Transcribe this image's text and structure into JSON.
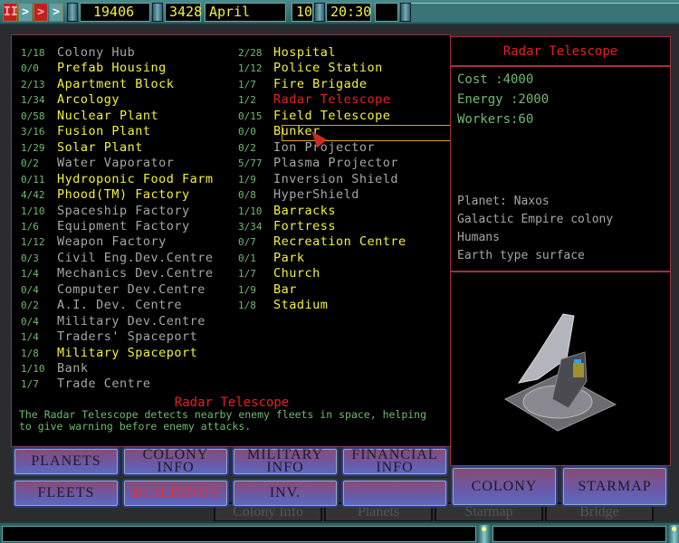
{
  "topbar": {
    "pause": "II",
    "play": ">",
    "fast": ">",
    "faster": ">",
    "credits": "19406",
    "year": "3428",
    "month": "April",
    "day": "10",
    "time": "20:30"
  },
  "background_tabs": [
    "Colony Info",
    "Planets",
    "Starmap",
    "Bridge"
  ],
  "buildings_left": [
    {
      "count": "1/18",
      "name": "Colony Hub",
      "available": false
    },
    {
      "count": "0/0",
      "name": "Prefab Housing",
      "available": true
    },
    {
      "count": "2/13",
      "name": "Apartment Block",
      "available": true
    },
    {
      "count": "1/34",
      "name": "Arcology",
      "available": true
    },
    {
      "count": "0/58",
      "name": "Nuclear Plant",
      "available": true
    },
    {
      "count": "3/16",
      "name": "Fusion Plant",
      "available": true
    },
    {
      "count": "1/29",
      "name": "Solar Plant",
      "available": true
    },
    {
      "count": "0/2",
      "name": "Water Vaporator",
      "available": false
    },
    {
      "count": "0/11",
      "name": "Hydroponic Food Farm",
      "available": true
    },
    {
      "count": "4/42",
      "name": "Phood(TM) Factory",
      "available": true
    },
    {
      "count": "1/10",
      "name": "Spaceship Factory",
      "available": false
    },
    {
      "count": "1/6",
      "name": "Equipment Factory",
      "available": false
    },
    {
      "count": "1/12",
      "name": "Weapon Factory",
      "available": false
    },
    {
      "count": "0/3",
      "name": "Civil Eng.Dev.Centre",
      "available": false
    },
    {
      "count": "1/4",
      "name": "Mechanics Dev.Centre",
      "available": false
    },
    {
      "count": "0/4",
      "name": "Computer Dev.Centre",
      "available": false
    },
    {
      "count": "0/2",
      "name": "A.I. Dev. Centre",
      "available": false
    },
    {
      "count": "0/4",
      "name": "Military Dev.Centre",
      "available": false
    },
    {
      "count": "1/4",
      "name": "Traders' Spaceport",
      "available": false
    },
    {
      "count": "1/8",
      "name": "Military Spaceport",
      "available": true
    },
    {
      "count": "1/10",
      "name": "Bank",
      "available": false
    },
    {
      "count": "1/7",
      "name": "Trade Centre",
      "available": false
    }
  ],
  "buildings_right": [
    {
      "count": "2/28",
      "name": "Hospital",
      "available": true
    },
    {
      "count": "1/12",
      "name": "Police Station",
      "available": true
    },
    {
      "count": "1/7",
      "name": "Fire Brigade",
      "available": true
    },
    {
      "count": "1/2",
      "name": "Radar Telescope",
      "available": true,
      "selected": true
    },
    {
      "count": "0/15",
      "name": "Field Telescope",
      "available": true
    },
    {
      "count": "0/0",
      "name": "Bunker",
      "available": true
    },
    {
      "count": "0/2",
      "name": "Ion Projector",
      "available": false
    },
    {
      "count": "5/77",
      "name": "Plasma Projector",
      "available": false
    },
    {
      "count": "1/9",
      "name": "Inversion Shield",
      "available": false
    },
    {
      "count": "0/8",
      "name": "HyperShield",
      "available": false
    },
    {
      "count": "1/10",
      "name": "Barracks",
      "available": true
    },
    {
      "count": "3/34",
      "name": "Fortress",
      "available": true
    },
    {
      "count": "0/7",
      "name": "Recreation Centre",
      "available": true
    },
    {
      "count": "0/1",
      "name": "Park",
      "available": true
    },
    {
      "count": "1/7",
      "name": "Church",
      "available": true
    },
    {
      "count": "1/9",
      "name": "Bar",
      "available": true
    },
    {
      "count": "1/8",
      "name": "Stadium",
      "available": true
    }
  ],
  "description": {
    "title": "Radar Telescope",
    "text": "The Radar Telescope detects nearby enemy fleets in space, helping to give warning before enemy attacks."
  },
  "nav_buttons": {
    "planets": "PLANETS",
    "colony_info": "COLONY INFO",
    "military_info": "MILITARY INFO",
    "financial_info": "FINANCIAL INFO",
    "fleets": "FLEETS",
    "buildings": "BUILDINGS",
    "inv": "INV.",
    "blank": ""
  },
  "details": {
    "title": "Radar Telescope",
    "cost": "Cost    :4000",
    "energy": "Energy :2000",
    "workers": "Workers:60",
    "planet": "Planet: Naxos",
    "owner": "Galactic Empire colony",
    "race": "Humans",
    "surface": "Earth type surface"
  },
  "right_buttons": {
    "colony": "COLONY",
    "starmap": "STARMAP"
  },
  "colors": {
    "available": "#f2f040",
    "unavailable": "#a6a6a6",
    "selected": "#e82020",
    "count": "#70b870"
  }
}
